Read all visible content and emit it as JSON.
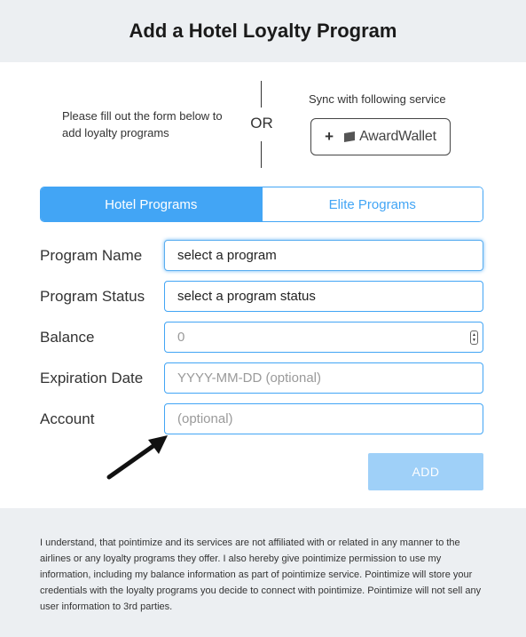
{
  "header": {
    "title": "Add a Hotel Loyalty Program"
  },
  "intro": {
    "text": "Please fill out the form below to add loyalty programs"
  },
  "separator": {
    "label": "OR"
  },
  "sync": {
    "label": "Sync with following service",
    "button_text": "AwardWallet",
    "button_icon": "plus-icon"
  },
  "tabs": [
    {
      "label": "Hotel Programs",
      "active": true
    },
    {
      "label": "Elite Programs",
      "active": false
    }
  ],
  "form": {
    "program_name": {
      "label": "Program Name",
      "value": "select a program"
    },
    "program_status": {
      "label": "Program Status",
      "value": "select a program status"
    },
    "balance": {
      "label": "Balance",
      "placeholder": "0"
    },
    "expiration_date": {
      "label": "Expiration Date",
      "placeholder": "YYYY-MM-DD (optional)"
    },
    "account": {
      "label": "Account",
      "placeholder": "(optional)"
    }
  },
  "actions": {
    "add_label": "ADD"
  },
  "footer": {
    "disclaimer": "I understand, that pointimize and its services are not affiliated with or related in any manner to the airlines or any loyalty programs they offer. I also hereby give pointimize permission to use my information, including my balance information as part of pointimize service. Pointimize will store your credentials with the loyalty programs you decide to connect with pointimize. Pointimize will not sell any user information to 3rd parties."
  },
  "colors": {
    "accent": "#42a5f5",
    "add_disabled": "#9fd0f8",
    "panel_bg": "#eceff2"
  }
}
